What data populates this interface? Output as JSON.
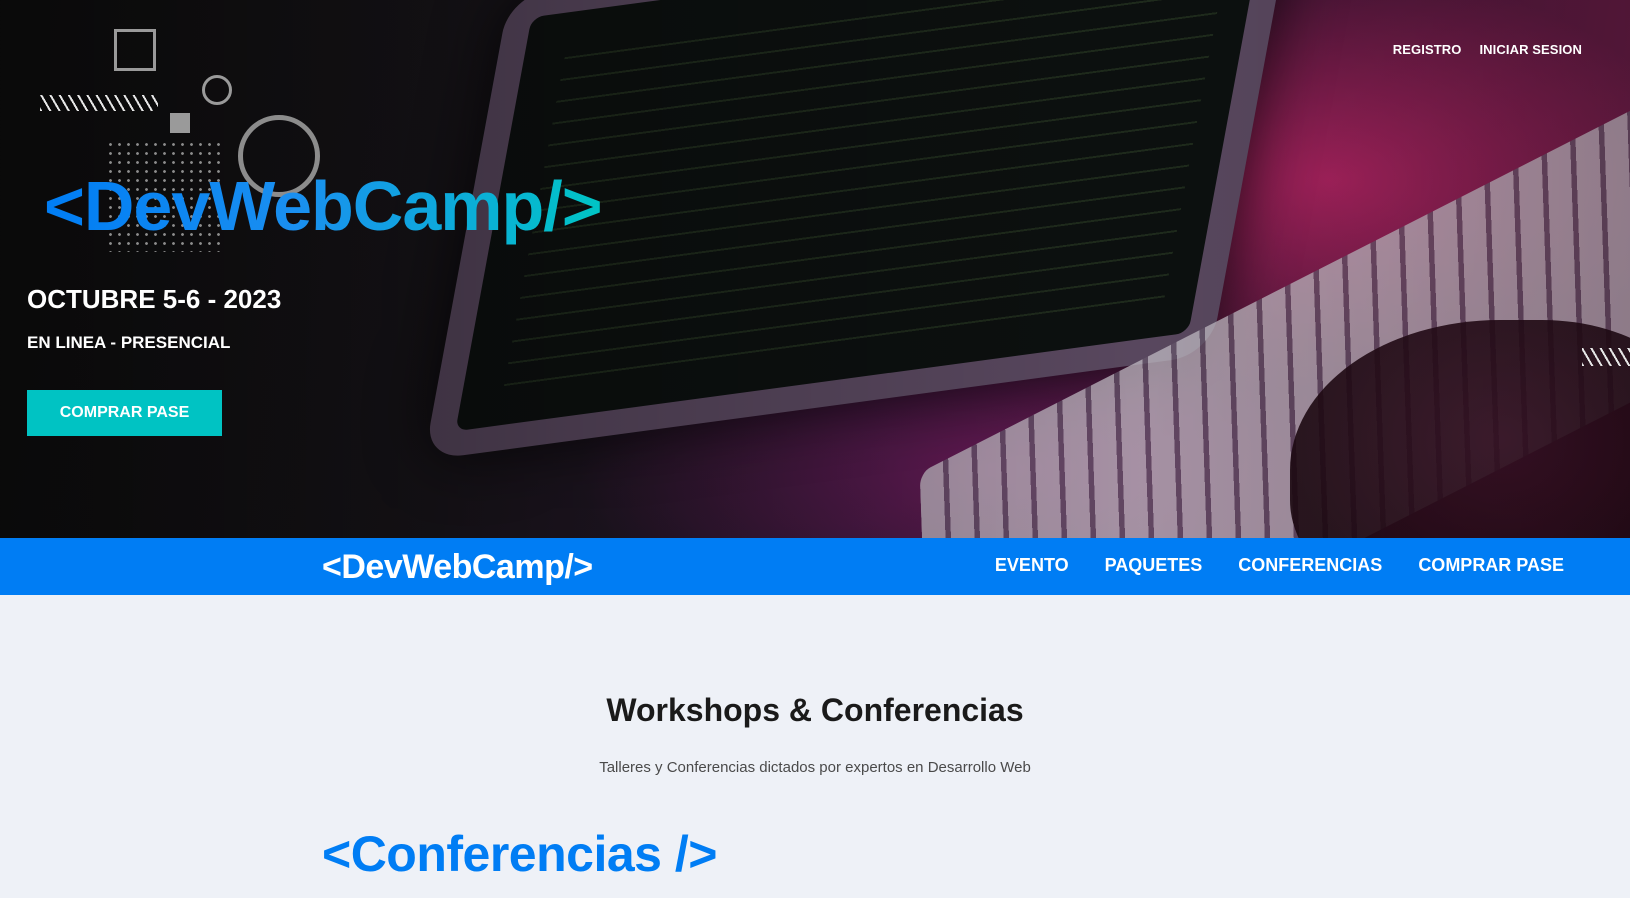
{
  "hero": {
    "top_nav": {
      "register": "REGISTRO",
      "login": "INICIAR SESION"
    },
    "logo": "<DevWebCamp/>",
    "date": "OCTUBRE 5-6 - 2023",
    "mode": "EN LINEA - PRESENCIAL",
    "cta": "COMPRAR PASE"
  },
  "navbar": {
    "logo": "<DevWebCamp/>",
    "links": [
      "EVENTO",
      "PAQUETES",
      "CONFERENCIAS",
      "COMPRAR PASE"
    ]
  },
  "main": {
    "title": "Workshops & Conferencias",
    "subtitle": "Talleres y Conferencias dictados por expertos en Desarrollo Web",
    "conferences_heading": "<Conferencias />"
  },
  "colors": {
    "brand_blue": "#007df4",
    "brand_teal": "#00c3c3",
    "page_bg": "#eef1f7"
  }
}
